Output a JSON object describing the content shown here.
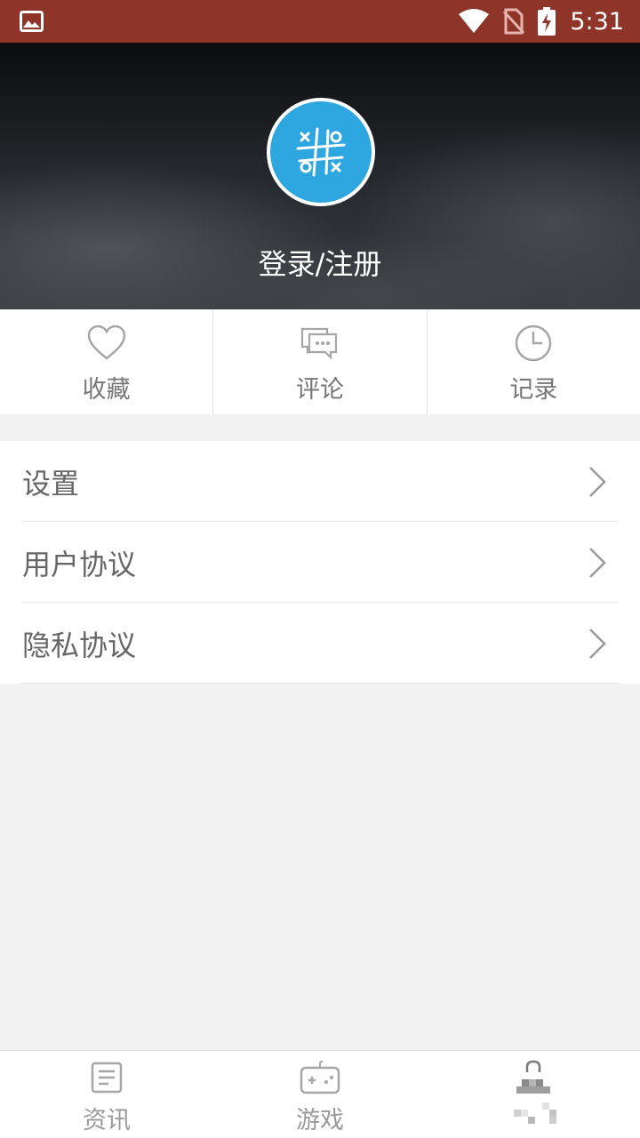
{
  "status_bar": {
    "time": "5:31",
    "background": "#8e3429",
    "icons": [
      "image-icon",
      "wifi-icon",
      "no-sim-icon",
      "battery-charging-icon"
    ]
  },
  "header": {
    "login_label": "登录/注册",
    "avatar_icon": "tic-tac-toe-icon",
    "avatar_color": "#2ea6e0"
  },
  "quick_actions": [
    {
      "label": "收藏",
      "icon": "heart-icon"
    },
    {
      "label": "评论",
      "icon": "comment-icon"
    },
    {
      "label": "记录",
      "icon": "clock-icon"
    }
  ],
  "menu": [
    {
      "label": "设置",
      "icon": "chevron-right-icon"
    },
    {
      "label": "用户协议",
      "icon": "chevron-right-icon"
    },
    {
      "label": "隐私协议",
      "icon": "chevron-right-icon"
    }
  ],
  "bottom_nav": [
    {
      "label": "资讯",
      "icon": "news-icon"
    },
    {
      "label": "游戏",
      "icon": "gamepad-icon"
    },
    {
      "label": "",
      "icon": "profile-icon"
    }
  ]
}
